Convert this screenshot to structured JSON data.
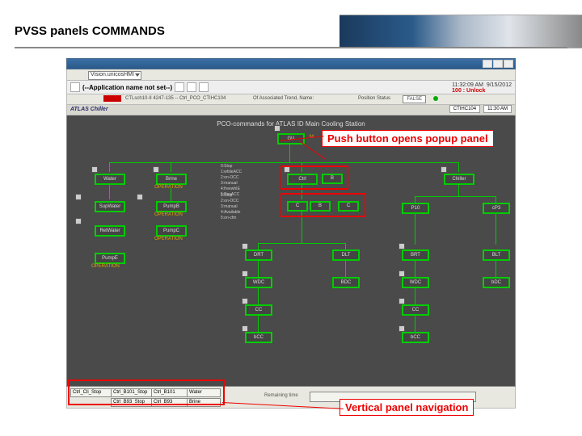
{
  "slide": {
    "title": "PVSS panels COMMANDS",
    "callout_push": "Push button opens popup panel",
    "callout_nav": "Vertical panel navigation"
  },
  "window": {
    "app_label": "(--Application name not set--)",
    "vision_field": "Vision.unicosHMI",
    "clock": "11:32:09 AM",
    "date_field": "9/15/2012",
    "unlock": "100 : Unlock",
    "redbar_txt": "CTLsch10-II 4247-135 -- Ctrl_PCO_CTIHC104",
    "assoc": "Of Associated Trend, Name:",
    "pos_status": "Position Status",
    "false_lbl": "FALSE",
    "subhead_brand": "ATLAS",
    "subhead_name": "Chiller",
    "subhead_r1": "CTIHC104",
    "subhead_r2": "11:30 AM"
  },
  "canvas": {
    "pco_title": "PCO-commands for ATLAS ID Main Cooling Station",
    "m_lbl": "M",
    "boxes": {
      "gu": "GU",
      "water": "Water",
      "brine": "Brine",
      "ctrl": "Ctrl",
      "chiller": "Chiller",
      "supwater": "SupWater",
      "pumpb": "PumpB",
      "b": "B",
      "c": "C",
      "p10": "P10",
      "p03": "cP3",
      "retwater": "RetWater",
      "pumpc": "PumpC",
      "pumpe": "PumpE",
      "drt": "DRT",
      "dlt": "DLT",
      "brt2": "BRT",
      "blt": "BLT",
      "wdc": "WDC",
      "bdc": "BDC",
      "wdc2": "WDC",
      "bdc2": "bDC",
      "cc": "CC",
      "cc2": "CC",
      "bcc": "bCC",
      "bcc2": "bCC"
    },
    "label_operation": "OPERATION",
    "list1_items": [
      "0:Stop",
      "1:whileACC",
      "2:on-OCC",
      "3:manual",
      "4:freewhIE",
      "5:PesACC"
    ],
    "list2_items": [
      "1:Stop",
      "2:on-OCC",
      "3:manual",
      "4:Available",
      "5:on-cfm"
    ]
  },
  "bottom": {
    "cells": [
      "Ctrl_Cli_Stop",
      "Ctrl_B101_Stop",
      "Ctrl_B101",
      "Water",
      "Ctrl_B93_Stop",
      "Ctrl_B93",
      "Brine"
    ],
    "remaining": "Remaining time"
  }
}
